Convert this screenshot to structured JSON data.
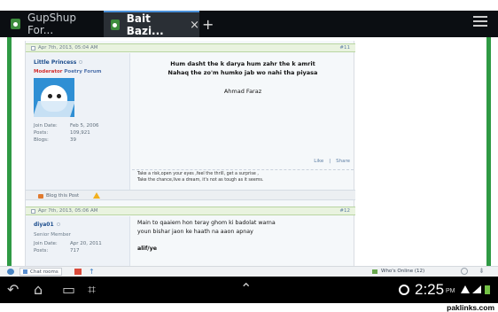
{
  "tabs": [
    {
      "label": "GupShup For...",
      "active": false
    },
    {
      "label": "Bait Bazi...",
      "active": true
    }
  ],
  "browser": {
    "new_tab": "+",
    "menu": "menu"
  },
  "posts": [
    {
      "date": "Apr 7th, 2013, 05:04 AM",
      "number": "#11",
      "user": {
        "name": "Little Princess",
        "title_prefix": "Moderator",
        "title_forum": "Poetry Forum",
        "join_label": "Join Date:",
        "join_value": "Feb 5, 2006",
        "posts_label": "Posts:",
        "posts_value": "109,921",
        "blogs_label": "Blogs:",
        "blogs_value": "39"
      },
      "body": [
        "Hum dasht the k darya hum zahr the k amrit",
        "Nahaq the zo'm humko jab wo nahi tha piyasa",
        "Ahmad Faraz"
      ],
      "actions": {
        "like": "Like",
        "share": "Share",
        "separator": "|"
      },
      "signature": [
        "Take a risk,open your eyes ,feel the thrill, get a surprise ,",
        "Take the chance,live a dream, it's not as tough as it seems."
      ],
      "footer": {
        "blog": "Blog this Post"
      }
    },
    {
      "date": "Apr 7th, 2013, 05:06 AM",
      "number": "#12",
      "user": {
        "name": "diya01",
        "title": "Senior Member",
        "join_label": "Join Date:",
        "join_value": "Apr 20, 2011",
        "posts_label": "Posts:",
        "posts_value": "717"
      },
      "body": [
        "Main to qaaiem hon teray ghom ki badolat warna",
        "youn bishar jaon ke haath na aaon apnay",
        "alif/ye"
      ]
    }
  ],
  "footer": {
    "chat": "Chat rooms",
    "whos_online": "Who's Online (12)"
  },
  "status": {
    "time": "2:25",
    "ampm": "PM"
  },
  "watermark": "paklinks.com",
  "colors": {
    "tab_bar": "#0b0e12",
    "green_border": "#2f9a44",
    "link_blue": "#1c4d8d",
    "moderator_red": "#d32d2d"
  }
}
